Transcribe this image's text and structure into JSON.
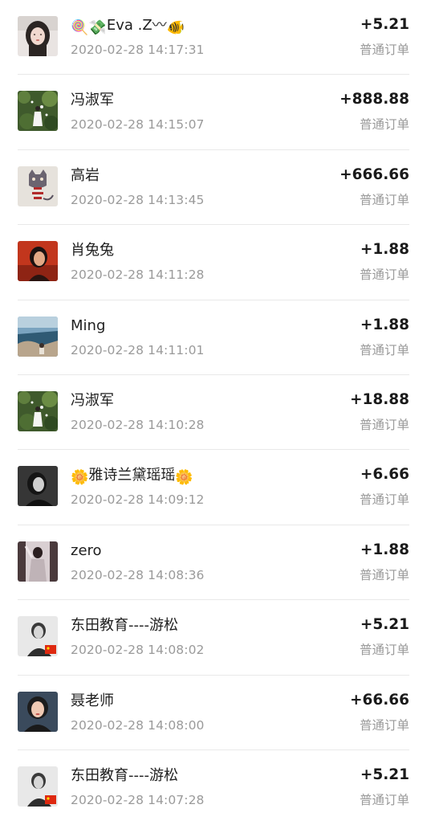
{
  "records": [
    {
      "avatar": "selfie-avatar",
      "name_prefix": "🍭💸",
      "name": "Eva .Z〰",
      "name_suffix": "🐠",
      "time": "2020-02-28 14:17:31",
      "amount": "+5.21",
      "order_type": "普通订单"
    },
    {
      "avatar": "garden-avatar",
      "name": "冯淑军",
      "time": "2020-02-28 14:15:07",
      "amount": "+888.88",
      "order_type": "普通订单"
    },
    {
      "avatar": "cat-sketch-avatar",
      "name": "高岩",
      "time": "2020-02-28 14:13:45",
      "amount": "+666.66",
      "order_type": "普通订单"
    },
    {
      "avatar": "red-portrait-avatar",
      "name": "肖兔兔",
      "time": "2020-02-28 14:11:28",
      "amount": "+1.88",
      "order_type": "普通订单"
    },
    {
      "avatar": "seaside-avatar",
      "name": "Ming",
      "time": "2020-02-28 14:11:01",
      "amount": "+1.88",
      "order_type": "普通订单"
    },
    {
      "avatar": "garden-avatar",
      "name": "冯淑军",
      "time": "2020-02-28 14:10:28",
      "amount": "+18.88",
      "order_type": "普通订单"
    },
    {
      "avatar": "bw-portrait-avatar",
      "name_prefix": "🌼 ",
      "name": "雅诗兰黛瑶瑶",
      "name_suffix": " 🌼",
      "time": "2020-02-28 14:09:12",
      "amount": "+6.66",
      "order_type": "普通订单"
    },
    {
      "avatar": "mirror-avatar",
      "name": "zero",
      "time": "2020-02-28 14:08:36",
      "amount": "+1.88",
      "order_type": "普通订单"
    },
    {
      "avatar": "flag-portrait-avatar",
      "name": "东田教育----游松",
      "time": "2020-02-28 14:08:02",
      "amount": "+5.21",
      "order_type": "普通订单"
    },
    {
      "avatar": "woman-portrait-avatar",
      "name": "聂老师",
      "time": "2020-02-28 14:08:00",
      "amount": "+66.66",
      "order_type": "普通订单"
    },
    {
      "avatar": "flag-portrait-avatar",
      "name": "东田教育----游松",
      "time": "2020-02-28 14:07:28",
      "amount": "+5.21",
      "order_type": "普通订单"
    }
  ]
}
